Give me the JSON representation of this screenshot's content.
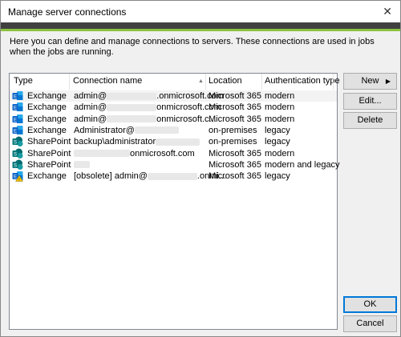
{
  "window": {
    "title": "Manage server connections",
    "close_glyph": "✕"
  },
  "description": "Here you can define and manage connections to servers. These connections are used in jobs when the jobs are running.",
  "table": {
    "columns": [
      "Type",
      "Connection name",
      "Location",
      "Authentication type"
    ],
    "rows": [
      {
        "type": "Exchange",
        "icon": "exchange-icon",
        "name_prefix": "admin@",
        "name_suffix": ".onmicrosoft.com",
        "location": "Microsoft 365",
        "auth": "modern"
      },
      {
        "type": "Exchange",
        "icon": "exchange-icon",
        "name_prefix": "admin@",
        "name_suffix": "onmicrosoft.com",
        "location": "Microsoft 365",
        "auth": "modern"
      },
      {
        "type": "Exchange",
        "icon": "exchange-icon",
        "name_prefix": "admin@",
        "name_suffix": "onmicrosoft.c...",
        "location": "Microsoft 365",
        "auth": "modern"
      },
      {
        "type": "Exchange",
        "icon": "exchange-icon",
        "name_prefix": "Administrator@",
        "name_suffix": "",
        "location": "on-premises",
        "auth": "legacy"
      },
      {
        "type": "SharePoint",
        "icon": "sharepoint-icon",
        "name_prefix": "backup\\administrator",
        "name_suffix": "",
        "location": "on-premises",
        "auth": "legacy"
      },
      {
        "type": "SharePoint",
        "icon": "sharepoint-icon",
        "name_prefix": "",
        "name_suffix": "onmicrosoft.com",
        "location": "Microsoft 365",
        "auth": "modern"
      },
      {
        "type": "SharePoint",
        "icon": "sharepoint-icon",
        "name_prefix": "",
        "name_suffix": "",
        "location": "Microsoft 365",
        "auth": "modern and legacy"
      },
      {
        "type": "Exchange",
        "icon": "exchange-warning-icon",
        "name_prefix": "[obsolete] admin@",
        "name_suffix": ".onmi...",
        "location": "Microsoft 365",
        "auth": "legacy"
      }
    ]
  },
  "buttons": {
    "new": "New",
    "new_arrow": "▶",
    "edit": "Edit...",
    "delete": "Delete",
    "ok": "OK",
    "cancel": "Cancel"
  },
  "colors": {
    "exchange": "#0a64c8",
    "sharepoint": "#036c70",
    "accent": "#8cc33f",
    "warning": "#f5c400"
  }
}
